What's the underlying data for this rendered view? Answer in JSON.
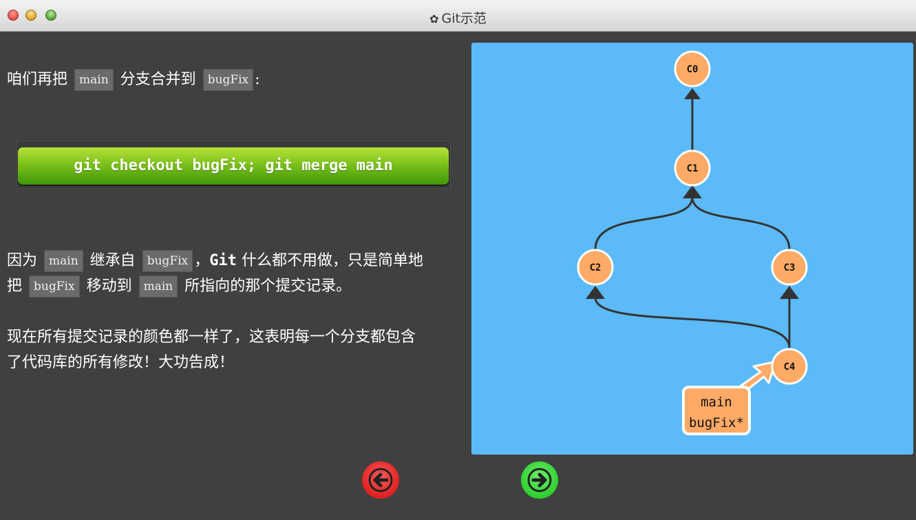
{
  "window": {
    "title": "Git示范",
    "title_icon": "gear-icon"
  },
  "intro": {
    "text_before": "咱们再把",
    "branch_a": "main",
    "text_mid": "分支合并到",
    "branch_b": "bugFix",
    "text_after": ":"
  },
  "command": {
    "label": "git checkout bugFix; git merge main"
  },
  "explain": {
    "t1": "因为",
    "c1": "main",
    "t2": "继承自",
    "c2": "bugFix",
    "t3": "，",
    "t4": "Git",
    "t5": "什么都不用做，只是简单地",
    "t6": "把",
    "c3": "bugFix",
    "t7": "移动到",
    "c4": "main",
    "t8": "所指向的那个提交记录。"
  },
  "summary": {
    "line1": "现在所有提交记录的颜色都一样了，这表明每一个分支都包含",
    "line2": "了代码库的所有修改！大功告成！"
  },
  "graph": {
    "background": "#5cbaf8",
    "node_color": "#ffaa66",
    "commits": [
      {
        "id": "C0"
      },
      {
        "id": "C1"
      },
      {
        "id": "C2"
      },
      {
        "id": "C3"
      },
      {
        "id": "C4"
      }
    ],
    "branch_labels": {
      "line1": "main",
      "line2": "bugFix*"
    }
  },
  "nav": {
    "back_color": "#e82828",
    "forward_color": "#39d439"
  }
}
